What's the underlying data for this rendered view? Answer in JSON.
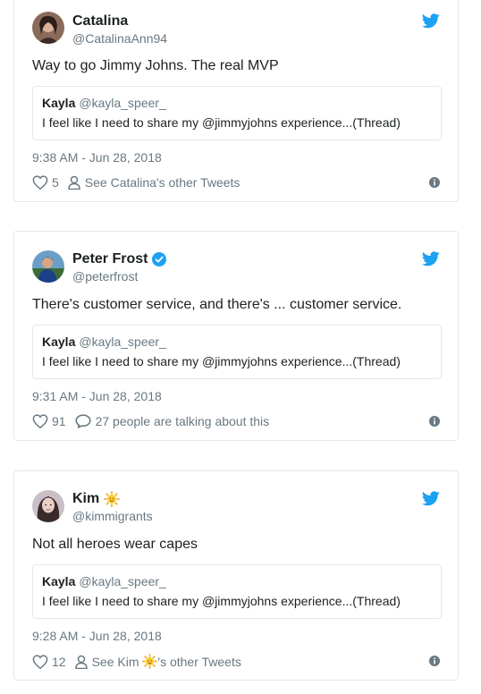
{
  "tweets": [
    {
      "name": "Catalina",
      "handle": "@CatalinaAnn94",
      "text": "Way to go Jimmy Johns. The real MVP",
      "quote": {
        "name": "Kayla",
        "handle": "@kayla_speer_",
        "text": "I feel like I need to share my @jimmyjohns experience...(Thread)"
      },
      "timestamp": "9:38 AM - Jun 28, 2018",
      "likes": "5",
      "link_text": "See Catalina's other Tweets"
    },
    {
      "name": "Peter Frost",
      "handle": "@peterfrost",
      "verified": true,
      "text": "There's customer service, and there's ... customer service.",
      "quote": {
        "name": "Kayla",
        "handle": "@kayla_speer_",
        "text": "I feel like I need to share my @jimmyjohns experience...(Thread)"
      },
      "timestamp": "9:31 AM - Jun 28, 2018",
      "likes": "91",
      "link_text": "27 people are talking about this"
    },
    {
      "name": "Kim",
      "name_emoji": "sun-emoji",
      "handle": "@kimmigrants",
      "text": "Not all heroes wear capes",
      "quote": {
        "name": "Kayla",
        "handle": "@kayla_speer_",
        "text": "I feel like I need to share my @jimmyjohns experience...(Thread)"
      },
      "timestamp": "9:28 AM - Jun 28, 2018",
      "likes": "12",
      "link_text_prefix": "See Kim",
      "link_text_suffix": "'s other Tweets"
    }
  ],
  "colors": {
    "twitter_blue": "#1da1f2",
    "muted": "#697882",
    "border": "#e1e8ed"
  }
}
